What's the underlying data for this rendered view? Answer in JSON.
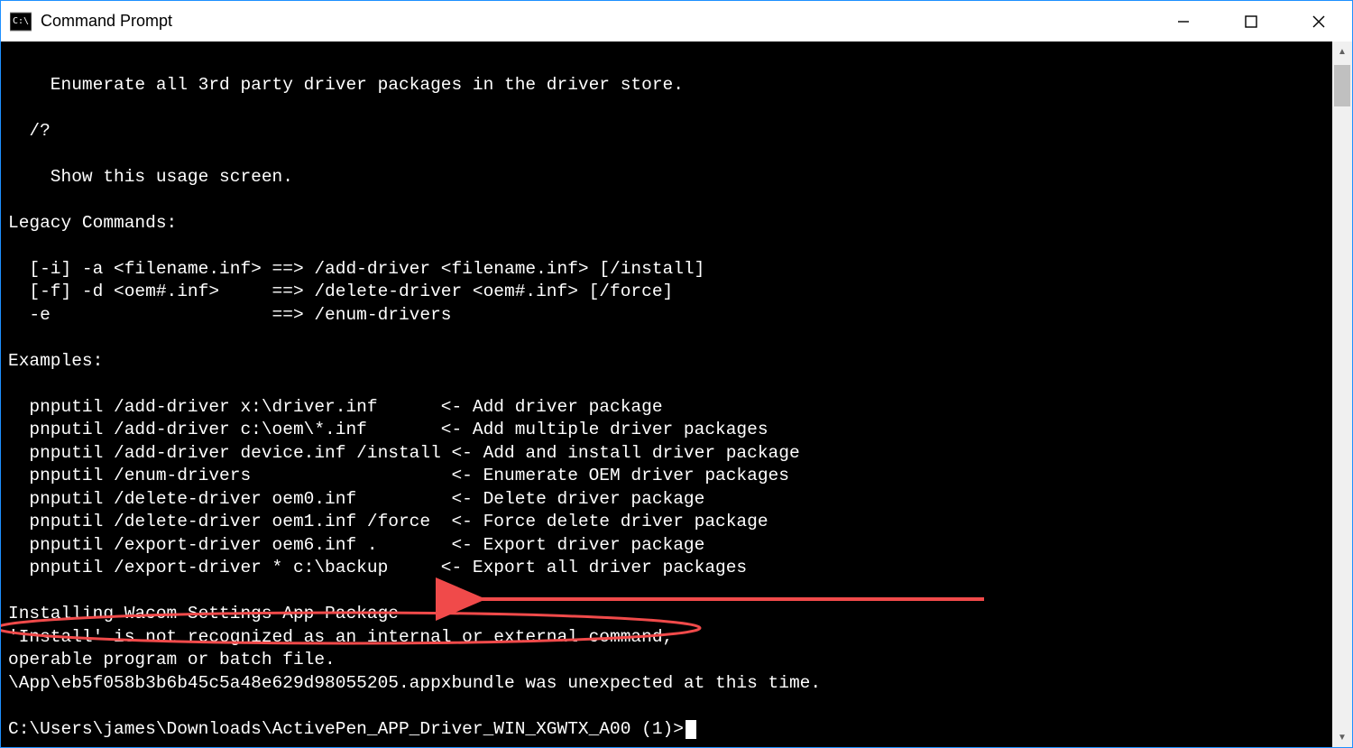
{
  "window": {
    "title": "Command Prompt"
  },
  "scroll": {
    "arrow_up_glyph": "▲",
    "arrow_down_glyph": "▼"
  },
  "terminal": {
    "lines": [
      "",
      "    Enumerate all 3rd party driver packages in the driver store.",
      "",
      "  /?",
      "",
      "    Show this usage screen.",
      "",
      "Legacy Commands:",
      "",
      "  [-i] -a <filename.inf> ==> /add-driver <filename.inf> [/install]",
      "  [-f] -d <oem#.inf>     ==> /delete-driver <oem#.inf> [/force]",
      "  -e                     ==> /enum-drivers",
      "",
      "Examples:",
      "",
      "  pnputil /add-driver x:\\driver.inf      <- Add driver package",
      "  pnputil /add-driver c:\\oem\\*.inf       <- Add multiple driver packages",
      "  pnputil /add-driver device.inf /install <- Add and install driver package",
      "  pnputil /enum-drivers                   <- Enumerate OEM driver packages",
      "  pnputil /delete-driver oem0.inf         <- Delete driver package",
      "  pnputil /delete-driver oem1.inf /force  <- Force delete driver package",
      "  pnputil /export-driver oem6.inf .       <- Export driver package",
      "  pnputil /export-driver * c:\\backup     <- Export all driver packages",
      "",
      "Installing Wacom Settings App Package",
      "'Install' is not recognized as an internal or external command,",
      "operable program or batch file.",
      "\\App\\eb5f058b3b6b45c5a48e629d98055205.appxbundle was unexpected at this time.",
      ""
    ],
    "prompt": "C:\\Users\\james\\Downloads\\ActivePen_APP_Driver_WIN_XGWTX_A00 (1)>"
  },
  "annotation": {
    "color": "#f04a4a",
    "highlighted_line_index": 25
  }
}
